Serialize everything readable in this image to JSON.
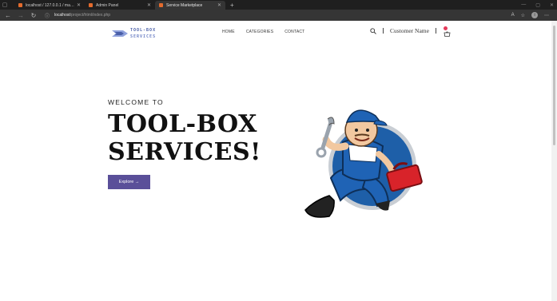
{
  "browser": {
    "tabs": [
      {
        "title": "localhost / 127.0.0.1 / market / a",
        "active": false,
        "favicon_color": "#e46b2d"
      },
      {
        "title": "Admin Panel",
        "active": false,
        "favicon_color": "#e46b2d"
      },
      {
        "title": "Service Marketplace",
        "active": true,
        "favicon_color": "#e46b2d"
      }
    ],
    "url_host": "localhost",
    "url_path": "/project/html/index.php",
    "profile_initial": "i"
  },
  "site": {
    "logo": {
      "line1": "TOOL-BOX",
      "line2": "SERVICES"
    },
    "nav": [
      {
        "label": "HOME"
      },
      {
        "label": "CATEGORIES"
      },
      {
        "label": "CONTACT"
      }
    ],
    "customer_name": "Customer Name"
  },
  "hero": {
    "welcome": "WELCOME TO",
    "headline_line1": "TOOL-BOX",
    "headline_line2": "SERVICES!",
    "cta_label": "Explore →"
  },
  "colors": {
    "accent": "#5a4f99",
    "badge": "#e53b5b",
    "logo_blue": "#4a5fa8"
  }
}
